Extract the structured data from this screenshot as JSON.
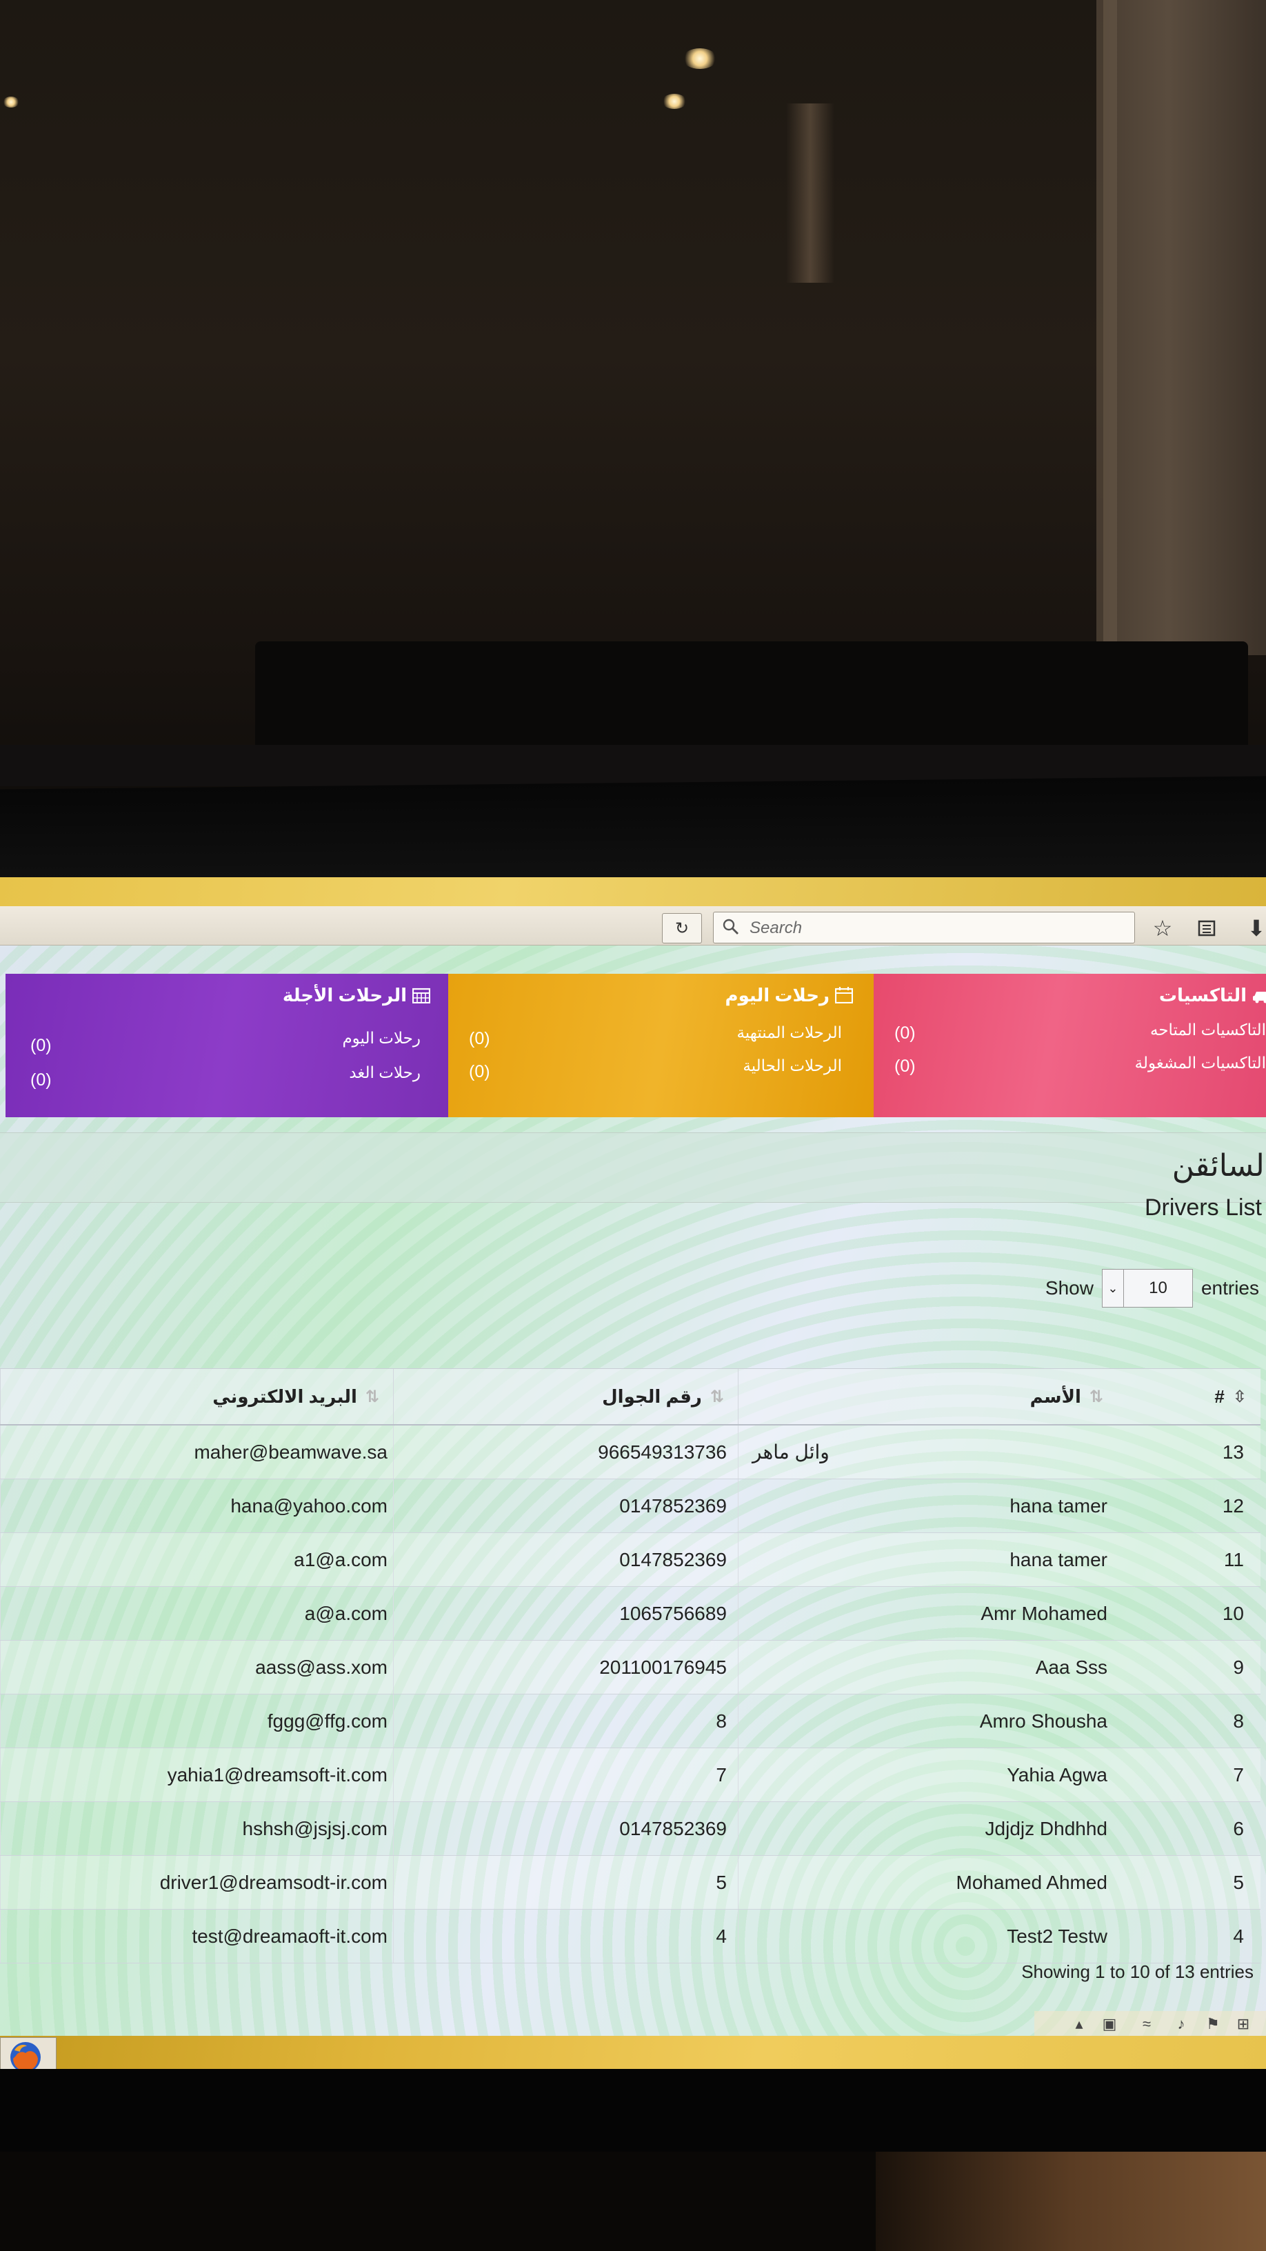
{
  "browser": {
    "search_placeholder": "Search"
  },
  "tiles": {
    "upcoming": {
      "title": "الرحلات الأجلة",
      "icon": "calendar-grid-icon",
      "rows": [
        {
          "label": "رحلات اليوم",
          "count": "(0)"
        },
        {
          "label": "رحلات الغد",
          "count": "(0)"
        }
      ]
    },
    "today": {
      "title": "رحلات اليوم",
      "icon": "calendar-icon",
      "rows": [
        {
          "label": "الرحلات المنتهية",
          "count": "(0)"
        },
        {
          "label": "الرحلات الحالية",
          "count": "(0)"
        }
      ]
    },
    "taxis": {
      "title": "التاكسيات",
      "icon": "car-icon",
      "rows": [
        {
          "label": "التاكسيات المتاحه",
          "count": "(0)"
        },
        {
          "label": "التاكسيات المشغولة",
          "count": "(0)"
        }
      ]
    }
  },
  "page": {
    "heading": "السائقن",
    "panel_title": "Drivers List"
  },
  "length_menu": {
    "show_label": "Show",
    "value": "10",
    "entries_label": "entries"
  },
  "table": {
    "headers": {
      "id": "#",
      "name": "الأسم",
      "phone": "رقم الجوال",
      "email": "البريد الالكتروني"
    },
    "rows": [
      {
        "id": "13",
        "name": "وائل ماهر",
        "phone": "966549313736",
        "email": "maher@beamwave.sa"
      },
      {
        "id": "12",
        "name": "hana tamer",
        "phone": "0147852369",
        "email": "hana@yahoo.com"
      },
      {
        "id": "11",
        "name": "hana tamer",
        "phone": "0147852369",
        "email": "a1@a.com"
      },
      {
        "id": "10",
        "name": "Amr Mohamed",
        "phone": "1065756689",
        "email": "a@a.com"
      },
      {
        "id": "9",
        "name": "Aaa Sss",
        "phone": "201100176945",
        "email": "aass@ass.xom"
      },
      {
        "id": "8",
        "name": "Amro Shousha",
        "phone": "8",
        "email": "fggg@ffg.com"
      },
      {
        "id": "7",
        "name": "Yahia Agwa",
        "phone": "7",
        "email": "yahia1@dreamsoft-it.com"
      },
      {
        "id": "6",
        "name": "Jdjdjz Dhdhhd",
        "phone": "0147852369",
        "email": "hshsh@jsjsj.com"
      },
      {
        "id": "5",
        "name": "Mohamed Ahmed",
        "phone": "5",
        "email": "driver1@dreamsodt-ir.com"
      },
      {
        "id": "4",
        "name": "Test2 Testw",
        "phone": "4",
        "email": "test@dreamaoft-it.com"
      }
    ]
  },
  "table_info": "Showing 1 to 10 of 13 entries",
  "colors": {
    "upcoming_tile": "#8d3cc8",
    "today_tile": "#f0b42a",
    "taxis_tile": "#f06486"
  }
}
